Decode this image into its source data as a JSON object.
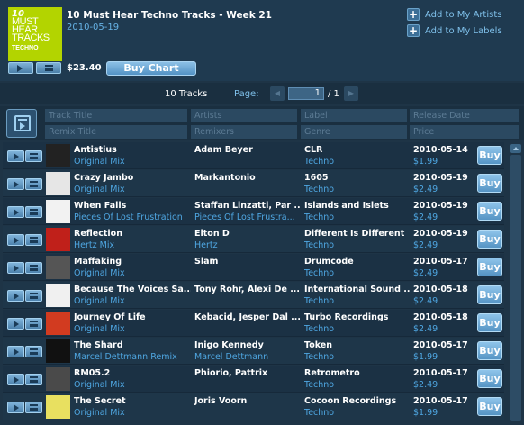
{
  "chart": {
    "cover": {
      "number": "10",
      "line1": "MUST HEAR",
      "line2": "TRACKS",
      "genre": "TECHNO"
    },
    "title": "10 Must Hear Techno Tracks - Week 21",
    "date": "2010-05-19",
    "price": "$23.40",
    "buy_label": "Buy Chart",
    "add_artists": "Add to My Artists",
    "add_labels": "Add to My Labels"
  },
  "pager": {
    "count": "10 Tracks",
    "page_label": "Page:",
    "page_value": "1",
    "of": "/ 1"
  },
  "filters": {
    "track_title": "Track Title",
    "remix_title": "Remix Title",
    "artists": "Artists",
    "remixers": "Remixers",
    "label": "Label",
    "genre": "Genre",
    "release_date": "Release Date",
    "price": "Price"
  },
  "buy_label": "Buy",
  "tracks": [
    {
      "title": "Antistius",
      "mix": "Original Mix",
      "artist": "Adam Beyer",
      "remixer": "",
      "label": "CLR",
      "genre": "Techno",
      "date": "2010-05-14",
      "price": "$1.99",
      "thumb_color": "#222222"
    },
    {
      "title": "Crazy Jambo",
      "mix": "Original Mix",
      "artist": "Markantonio",
      "remixer": "",
      "label": "1605",
      "genre": "Techno",
      "date": "2010-05-19",
      "price": "$2.49",
      "thumb_color": "#e6e6e6"
    },
    {
      "title": "When Falls",
      "mix": "Pieces Of Lost Frustration",
      "artist": "Staffan Linzatti,  Par ...",
      "remixer": "Pieces Of Lost Frustra...",
      "label": "Islands and Islets",
      "genre": "Techno",
      "date": "2010-05-19",
      "price": "$2.49",
      "thumb_color": "#f2f2f2"
    },
    {
      "title": "Reflection",
      "mix": "Hertz Mix",
      "artist": "Elton D",
      "remixer": "Hertz",
      "label": "Different Is Different",
      "genre": "Techno",
      "date": "2010-05-19",
      "price": "$2.49",
      "thumb_color": "#c0201a"
    },
    {
      "title": "Maffaking",
      "mix": "Original Mix",
      "artist": "Slam",
      "remixer": "",
      "label": "Drumcode",
      "genre": "Techno",
      "date": "2010-05-17",
      "price": "$2.49",
      "thumb_color": "#555555"
    },
    {
      "title": "Because The Voices Sa...",
      "mix": "Original Mix",
      "artist": "Tony Rohr,  Alexi De ...",
      "remixer": "",
      "label": "International Sound ...",
      "genre": "Techno",
      "date": "2010-05-18",
      "price": "$2.49",
      "thumb_color": "#f0f0f0"
    },
    {
      "title": "Journey Of Life",
      "mix": "Original Mix",
      "artist": "Kebacid,  Jesper Dal ...",
      "remixer": "",
      "label": "Turbo Recordings",
      "genre": "Techno",
      "date": "2010-05-18",
      "price": "$2.49",
      "thumb_color": "#d23b20"
    },
    {
      "title": "The Shard",
      "mix": "Marcel Dettmann Remix",
      "artist": "Inigo Kennedy",
      "remixer": "Marcel Dettmann",
      "label": "Token",
      "genre": "Techno",
      "date": "2010-05-17",
      "price": "$1.99",
      "thumb_color": "#111111"
    },
    {
      "title": "RM05.2",
      "mix": "Original Mix",
      "artist": "Phiorio,  Pattrix",
      "remixer": "",
      "label": "Retrometro",
      "genre": "Techno",
      "date": "2010-05-17",
      "price": "$2.49",
      "thumb_color": "#4a4a4a"
    },
    {
      "title": "The Secret",
      "mix": "Original Mix",
      "artist": "Joris Voorn",
      "remixer": "",
      "label": "Cocoon Recordings",
      "genre": "Techno",
      "date": "2010-05-17",
      "price": "$1.99",
      "thumb_color": "#e8e060"
    }
  ]
}
